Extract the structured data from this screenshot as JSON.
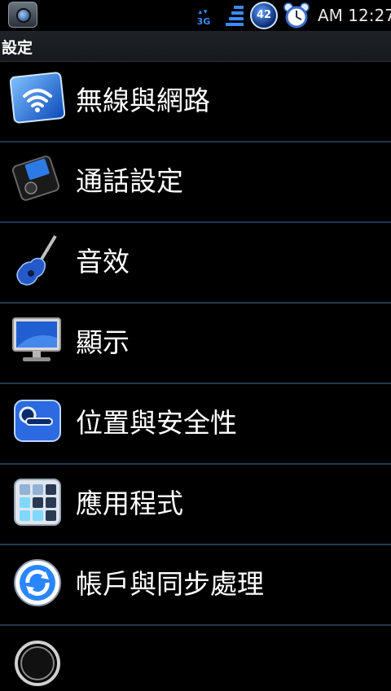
{
  "status_bar": {
    "network_type": "3G",
    "battery_level": "42",
    "time": "AM 12:27",
    "icons": [
      "notification-icon",
      "network-3g-icon",
      "signal-icon",
      "battery-icon",
      "alarm-icon"
    ]
  },
  "title_bar": {
    "title": "設定"
  },
  "settings": {
    "items": [
      {
        "label": "無線與網路",
        "icon": "wifi-icon"
      },
      {
        "label": "通話設定",
        "icon": "phone-icon"
      },
      {
        "label": "音效",
        "icon": "guitar-icon"
      },
      {
        "label": "顯示",
        "icon": "monitor-icon"
      },
      {
        "label": "位置與安全性",
        "icon": "location-security-icon"
      },
      {
        "label": "應用程式",
        "icon": "applications-icon"
      },
      {
        "label": "帳戶與同步處理",
        "icon": "sync-icon"
      }
    ]
  },
  "colors": {
    "accent_blue": "#3a8cff",
    "divider": "#22384e",
    "title_bar_bg": "#1f2328",
    "text": "#ffffff"
  }
}
